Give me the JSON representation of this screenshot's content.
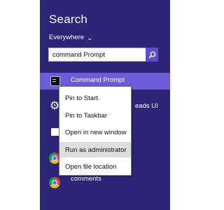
{
  "search": {
    "title": "Search",
    "scope_label": "Everywhere",
    "query": "command Prompt"
  },
  "results": {
    "top": {
      "label": "Command Prompt",
      "icon": "command-prompt-icon"
    },
    "second_partial_label": "eads UI",
    "last_partial_label": "comments"
  },
  "context_menu": {
    "items": [
      {
        "label": "Pin to Start"
      },
      {
        "label": "Pin to Taskbar"
      },
      {
        "label": "Open in new window"
      },
      {
        "label": "Run as administrator"
      },
      {
        "label": "Open file location"
      }
    ],
    "highlighted_item": "Run as administrator"
  },
  "colors": {
    "panel_bg": "#2d2577",
    "result_highlight": "#6b5cd9",
    "search_button": "#5a4fc9",
    "menu_hover": "#dedede"
  }
}
